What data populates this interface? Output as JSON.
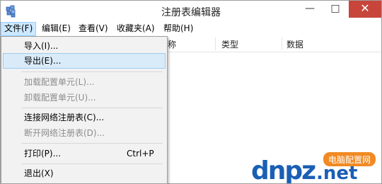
{
  "window": {
    "title": "注册表编辑器",
    "controls": {
      "minimize": "—",
      "maximize": "□",
      "close": "✕"
    }
  },
  "menubar": {
    "items": [
      {
        "label": "文件(F)"
      },
      {
        "label": "编辑(E)"
      },
      {
        "label": "查看(V)"
      },
      {
        "label": "收藏夹(A)"
      },
      {
        "label": "帮助(H)"
      }
    ]
  },
  "columns": {
    "name_partial": "称",
    "type": "类型",
    "data": "数据"
  },
  "file_menu": {
    "import": "导入(I)...",
    "export": "导出(E)...",
    "load_hive": "加载配置单元(L)...",
    "unload_hive": "卸载配置单元(U)...",
    "connect_network": "连接网络注册表(C)...",
    "disconnect_network": "断开网络注册表(D)...",
    "print": "打印(P)...",
    "print_shortcut": "Ctrl+P",
    "exit": "退出(X)"
  },
  "watermark": {
    "logo": "dnpz.net",
    "badge": "电脑配置网"
  },
  "colors": {
    "accent": "#cce8ff",
    "close": "#c7453b",
    "watermark_blue": "#1a5fb4",
    "watermark_orange": "#f08a24"
  },
  "icons": [
    "registry-editor-icon",
    "minimize-icon",
    "maximize-icon",
    "close-icon"
  ]
}
